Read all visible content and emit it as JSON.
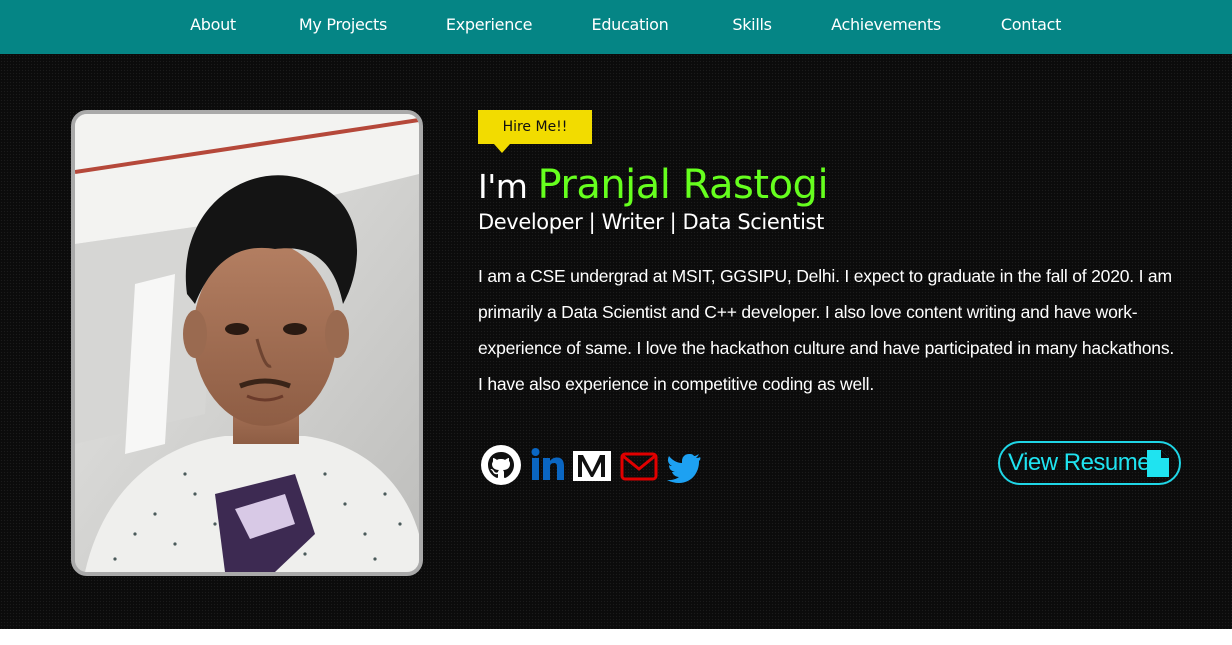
{
  "nav": {
    "items": [
      {
        "label": "About"
      },
      {
        "label": "My Projects"
      },
      {
        "label": "Experience"
      },
      {
        "label": "Education"
      },
      {
        "label": "Skills"
      },
      {
        "label": "Achievements"
      },
      {
        "label": "Contact"
      }
    ]
  },
  "hero": {
    "hire_label": "Hire Me!!",
    "greeting_prefix": "I'm ",
    "name": "Pranjal Rastogi",
    "roles": "Developer | Writer | Data Scientist",
    "bio": "I am a CSE undergrad at MSIT, GGSIPU, Delhi. I expect to graduate in the fall of 2020. I am primarily a Data Scientist and C++ developer. I also love content writing and have work-experience of same. I love the hackathon culture and have participated in many hackathons. I have also experience in competitive coding as well.",
    "resume_label": "View Resume",
    "socials": [
      {
        "icon": "github-icon"
      },
      {
        "icon": "linkedin-icon"
      },
      {
        "icon": "medium-icon"
      },
      {
        "icon": "email-icon"
      },
      {
        "icon": "twitter-icon"
      }
    ]
  },
  "colors": {
    "nav_bg": "#058585",
    "name_green": "#66ff1e",
    "badge_yellow": "#f2dc00",
    "resume_cyan": "#1fd6e6",
    "linkedin_blue": "#0a66c2",
    "email_red": "#e00000",
    "twitter_blue": "#1da1f2"
  }
}
